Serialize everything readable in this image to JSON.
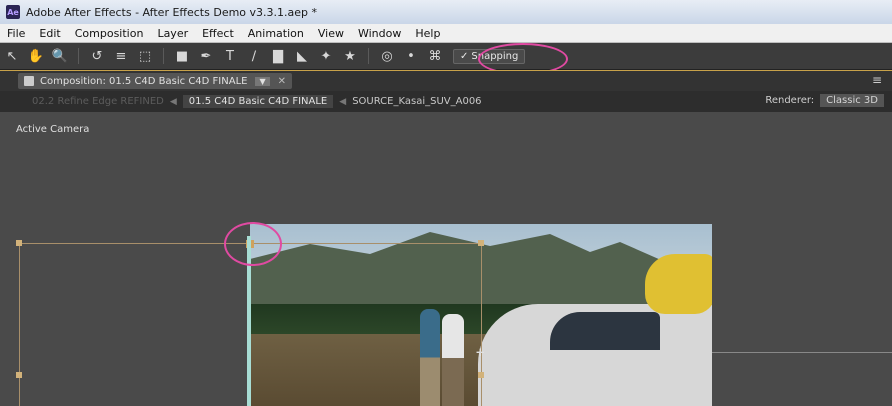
{
  "window": {
    "title": "Adobe After Effects - After Effects Demo v3.3.1.aep *",
    "app_icon": "Ae"
  },
  "menu": [
    "File",
    "Edit",
    "Composition",
    "Layer",
    "Effect",
    "Animation",
    "View",
    "Window",
    "Help"
  ],
  "toolbar": {
    "tools": [
      "selection-tool",
      "hand-tool",
      "zoom-tool",
      "rotate-tool",
      "camera-tool",
      "pan-behind-tool",
      "rectangle-mask-tool",
      "pen-tool",
      "type-tool",
      "brush-tool",
      "clone-stamp-tool",
      "eraser-tool",
      "roto-brush-tool",
      "puppet-tool"
    ],
    "snapping_label": "Snapping",
    "snapping_checked": true
  },
  "panel": {
    "tab_label": "Composition: 01.5 C4D Basic C4D FINALE"
  },
  "flow": {
    "previous": "02.2 Refine Edge REFINED",
    "active": "01.5 C4D Basic C4D FINALE",
    "next": "SOURCE_Kasai_SUV_A006"
  },
  "renderer": {
    "label": "Renderer:",
    "value": "Classic 3D"
  },
  "viewer": {
    "camera_label": "Active Camera"
  },
  "colors": {
    "annotation": "#e04aa2",
    "snap_line": "#a8ddd4",
    "bbox": "#a88f6a"
  }
}
